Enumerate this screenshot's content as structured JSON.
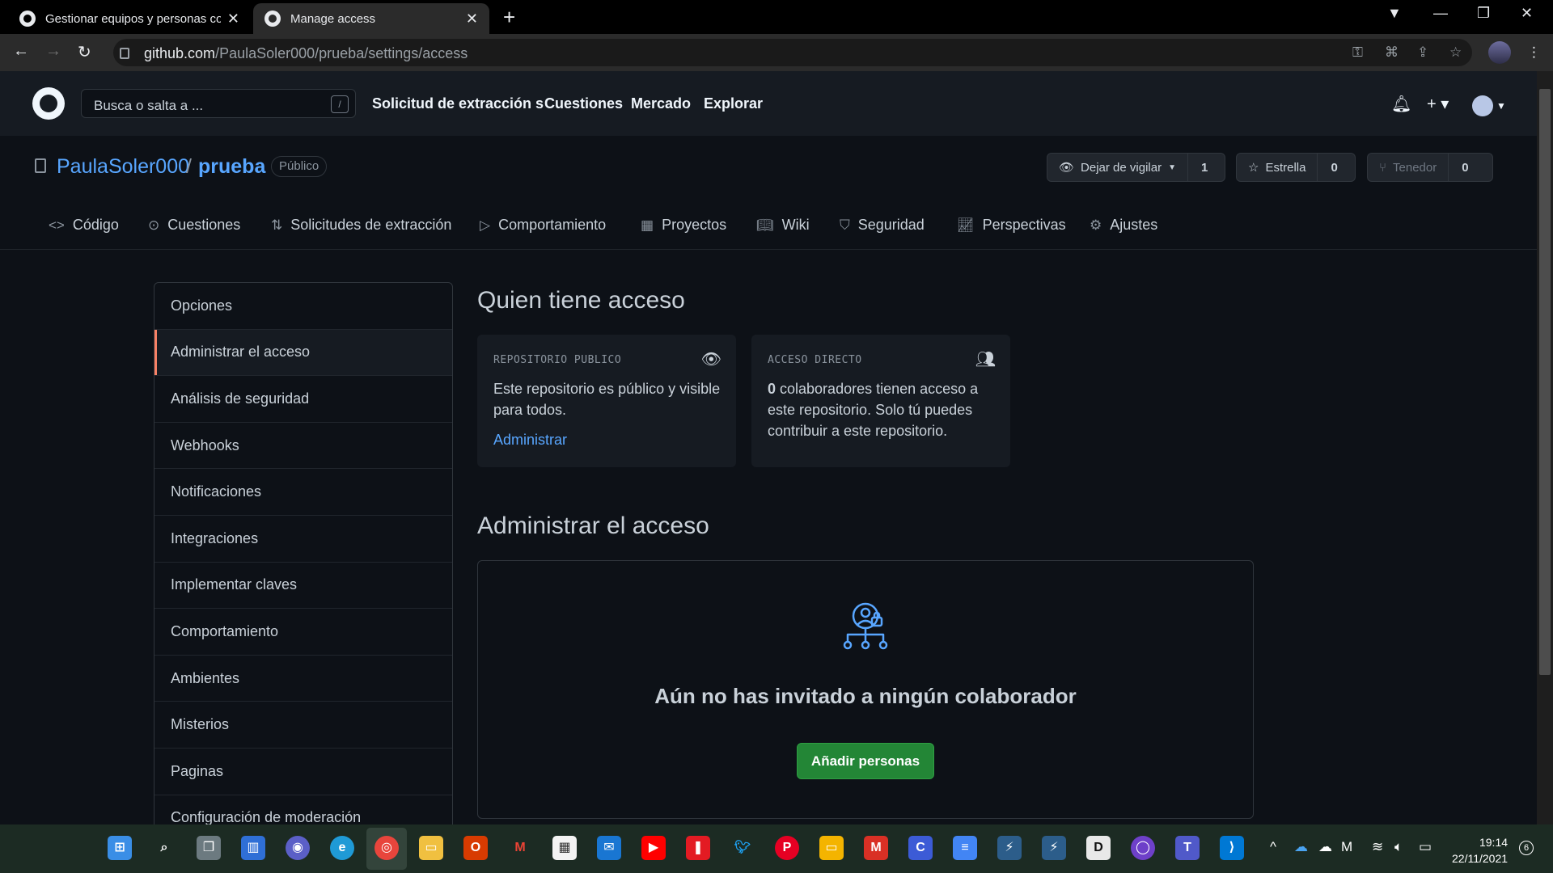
{
  "browser": {
    "tabs": [
      {
        "title": "Gestionar equipos y personas co",
        "active": false
      },
      {
        "title": "Manage access",
        "active": true
      }
    ],
    "new_tab": "+",
    "url_host": "github.com",
    "url_path": "/PaulaSoler000/prueba/settings/access"
  },
  "header": {
    "search_placeholder": "Busca o salta a ...",
    "slash_key": "/",
    "nav": [
      "Solicitud de extracción s",
      "Cuestiones",
      "Mercado",
      "Explorar"
    ]
  },
  "repo": {
    "owner": "PaulaSoler000",
    "separator": "/",
    "name": "prueba",
    "visibility": "Público",
    "watch": {
      "label": "Dejar de vigilar",
      "count": "1"
    },
    "star": {
      "label": "Estrella",
      "count": "0"
    },
    "fork": {
      "label": "Tenedor",
      "count": "0"
    }
  },
  "repo_tabs": [
    "Código",
    "Cuestiones",
    "Solicitudes de extracción",
    "Comportamiento",
    "Proyectos",
    "Wiki",
    "Seguridad",
    "Perspectivas",
    "Ajustes"
  ],
  "sidebar": {
    "items": [
      "Opciones",
      "Administrar el acceso",
      "Análisis de seguridad",
      "Webhooks",
      "Notificaciones",
      "Integraciones",
      "Implementar claves",
      "Comportamiento",
      "Ambientes",
      "Misterios",
      "Paginas",
      "Configuración de moderación"
    ],
    "selected_index": 1
  },
  "main": {
    "who_title": "Quien tiene acceso",
    "public_card": {
      "title": "REPOSITORIO PUBLICO",
      "text": "Este repositorio es público y visible para todos.",
      "link": "Administrar"
    },
    "direct_card": {
      "title": "ACCESO DIRECTO",
      "count": "0",
      "text": " colaboradores tienen acceso a este repositorio. Solo tú puedes contribuir a este repositorio."
    },
    "manage_title": "Administrar el acceso",
    "empty_title": "Aún no has invitado a ningún colaborador",
    "add_button": "Añadir personas"
  },
  "taskbar": {
    "time": "19:14",
    "date": "22/11/2021",
    "notifications": "6"
  },
  "colors": {
    "accent_link": "#58a6ff",
    "selected_marker": "#f78166",
    "primary_button": "#238636"
  }
}
